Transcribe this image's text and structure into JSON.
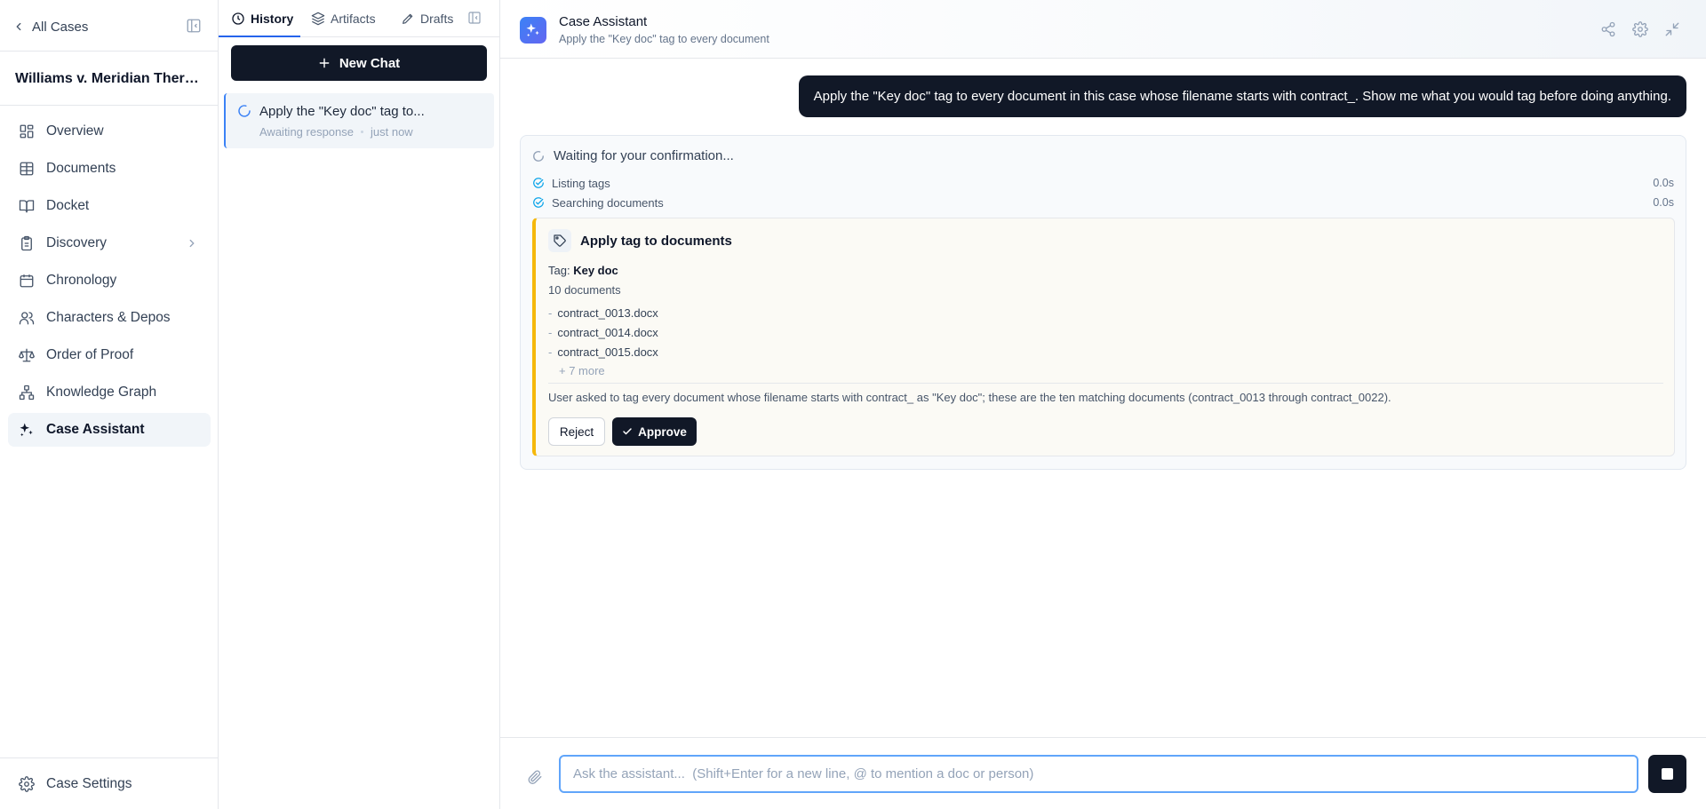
{
  "sidebar": {
    "back_label": "All Cases",
    "case_title": "Williams v. Meridian Therap...",
    "items": [
      {
        "label": "Overview",
        "icon": "grid-icon"
      },
      {
        "label": "Documents",
        "icon": "table-icon"
      },
      {
        "label": "Docket",
        "icon": "book-icon"
      },
      {
        "label": "Discovery",
        "icon": "clipboard-icon",
        "has_submenu": true
      },
      {
        "label": "Chronology",
        "icon": "calendar-icon"
      },
      {
        "label": "Characters & Depos",
        "icon": "users-icon"
      },
      {
        "label": "Order of Proof",
        "icon": "scale-icon"
      },
      {
        "label": "Knowledge Graph",
        "icon": "network-icon"
      },
      {
        "label": "Case Assistant",
        "icon": "sparkles-icon",
        "active": true
      }
    ],
    "settings_label": "Case Settings"
  },
  "history": {
    "tabs": [
      {
        "label": "History",
        "icon": "clock-icon",
        "active": true
      },
      {
        "label": "Artifacts",
        "icon": "layers-icon"
      },
      {
        "label": "Drafts",
        "icon": "pen-icon"
      }
    ],
    "new_chat_label": "New Chat",
    "chats": [
      {
        "title": "Apply the \"Key doc\" tag to...",
        "status": "Awaiting response",
        "time": "just now"
      }
    ]
  },
  "header": {
    "title": "Case Assistant",
    "subtitle": "Apply the \"Key doc\" tag to every document"
  },
  "conversation": {
    "user_message": "Apply the \"Key doc\" tag to every document in this case whose filename starts with contract_. Show me what you would tag before doing anything.",
    "status": "Waiting for your confirmation...",
    "steps": [
      {
        "label": "Listing tags",
        "time": "0.0s"
      },
      {
        "label": "Searching documents",
        "time": "0.0s"
      }
    ],
    "tool": {
      "title": "Apply tag to documents",
      "tag_label": "Tag:",
      "tag_value": "Key doc",
      "count": "10 documents",
      "documents": [
        "contract_0013.docx",
        "contract_0014.docx",
        "contract_0015.docx"
      ],
      "more": "+ 7 more",
      "reason": "User asked to tag every document whose filename starts with contract_ as \"Key doc\"; these are the ten matching documents (contract_0013 through contract_0022).",
      "reject_label": "Reject",
      "approve_label": "Approve"
    }
  },
  "composer": {
    "placeholder": "Ask the assistant...  (Shift+Enter for a new line, @ to mention a doc or person)",
    "value": ""
  },
  "colors": {
    "accent": "#2563eb",
    "dark_button": "#111827",
    "tool_border": "#f5b80b",
    "check": "#0ea5e9"
  }
}
